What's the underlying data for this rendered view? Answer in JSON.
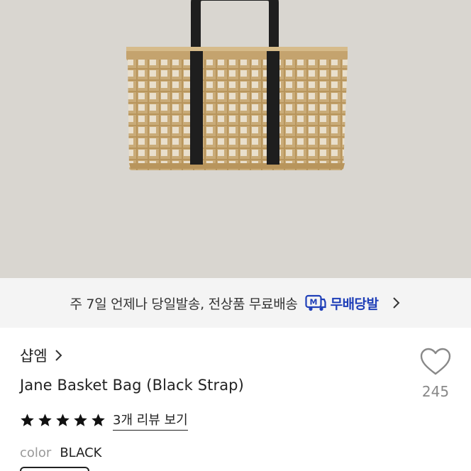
{
  "hero": {
    "image_icon": "basket-bag-product-image",
    "background_color": "#d9d6d0"
  },
  "shipping": {
    "text": "주 7일 언제나 당일발송, 전상품 무료배송",
    "badge_icon": "m-delivery-icon",
    "badge_label": "무배당발",
    "accent_color": "#1f3fb8"
  },
  "product": {
    "brand": "샵엠",
    "name": "Jane Basket Bag (Black Strap)",
    "rating_stars": 5,
    "review_link": "3개 리뷰 보기",
    "color_label": "color",
    "color_value": "BLACK"
  },
  "like": {
    "icon": "heart-icon",
    "count": "245"
  }
}
